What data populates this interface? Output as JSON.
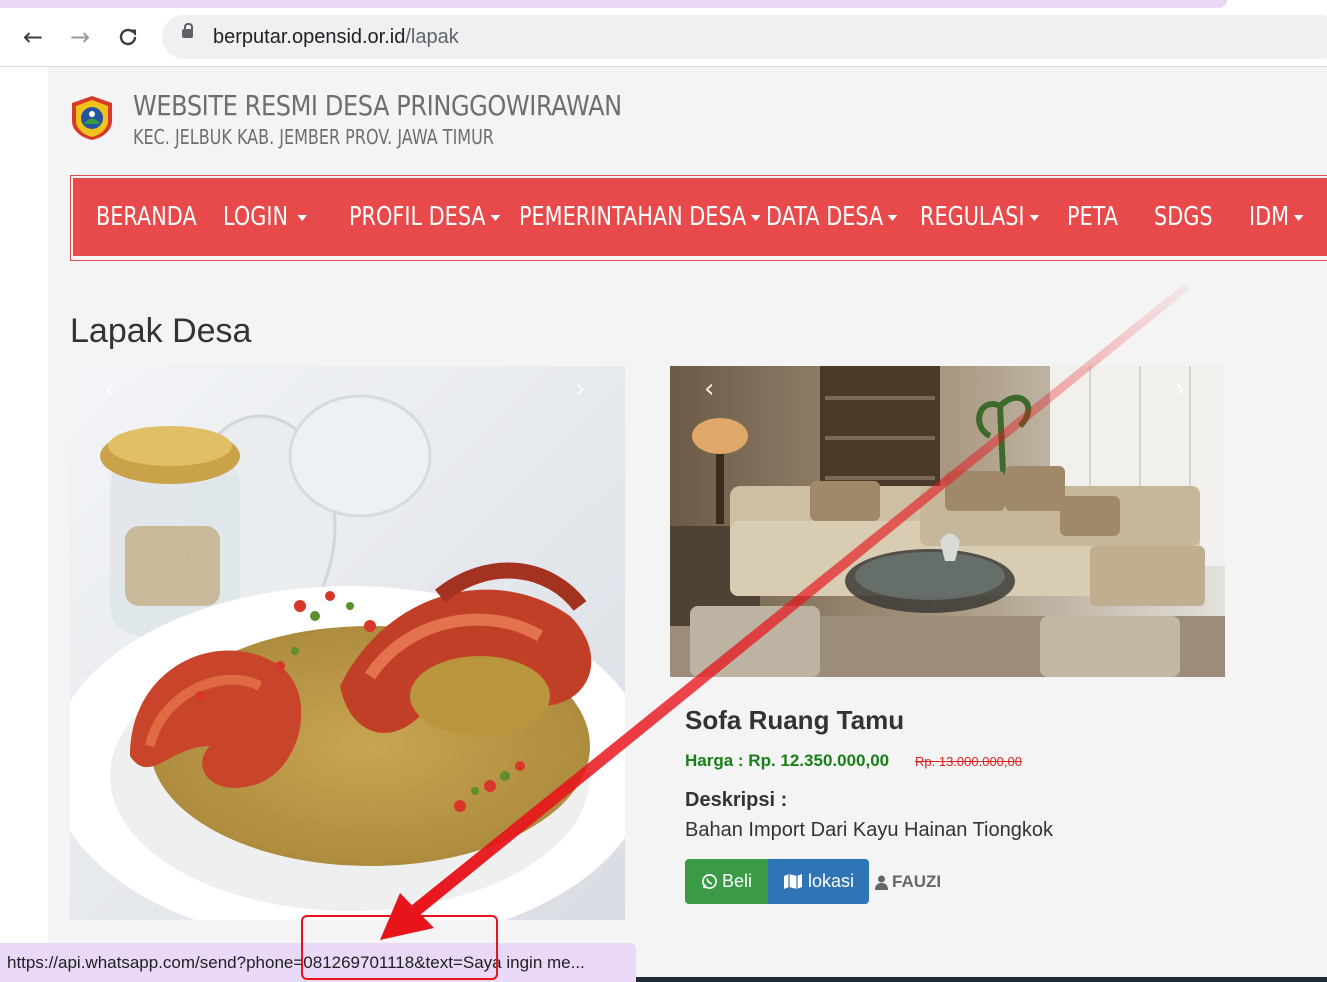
{
  "browser": {
    "url_domain": "berputar.opensid.or.id",
    "url_path": "/lapak",
    "status_url": "https://api.whatsapp.com/send?phone=081269701118&text=Saya ingin me..."
  },
  "site": {
    "title": "WEBSITE RESMI DESA PRINGGOWIRAWAN",
    "subtitle": "KEC. JELBUK KAB. JEMBER PROV. JAWA TIMUR"
  },
  "nav": {
    "items": [
      {
        "label": "BERANDA",
        "dropdown": false
      },
      {
        "label": "LOGIN",
        "dropdown": true
      },
      {
        "label": "PROFIL DESA",
        "dropdown": true
      },
      {
        "label": "PEMERINTAHAN DESA",
        "dropdown": true
      },
      {
        "label": "DATA DESA",
        "dropdown": true
      },
      {
        "label": "REGULASI",
        "dropdown": true
      },
      {
        "label": "PETA",
        "dropdown": false
      },
      {
        "label": "SDGS",
        "dropdown": false
      },
      {
        "label": "IDM",
        "dropdown": true
      }
    ]
  },
  "page": {
    "heading": "Lapak Desa"
  },
  "product": {
    "name": "Sofa Ruang Tamu",
    "price": "Harga : Rp. 12.350.000,00",
    "price_old": "Rp. 13.000.000,00",
    "desc_label": "Deskripsi :",
    "desc": "Bahan Import Dari Kayu Hainan Tiongkok",
    "buy_label": "Beli",
    "location_label": "lokasi",
    "seller": "FAUZI"
  },
  "colors": {
    "navbar": "#e8494a",
    "buy_button": "#3a9a45",
    "location_button": "#2f74b5",
    "price": "#198019",
    "annotation": "#e8141b"
  },
  "icons": {
    "back": "arrow-left",
    "forward": "arrow-right",
    "reload": "reload",
    "lock": "lock",
    "carousel_prev": "chevron-left",
    "carousel_next": "chevron-right",
    "whatsapp": "whatsapp",
    "map": "map",
    "user": "user"
  }
}
